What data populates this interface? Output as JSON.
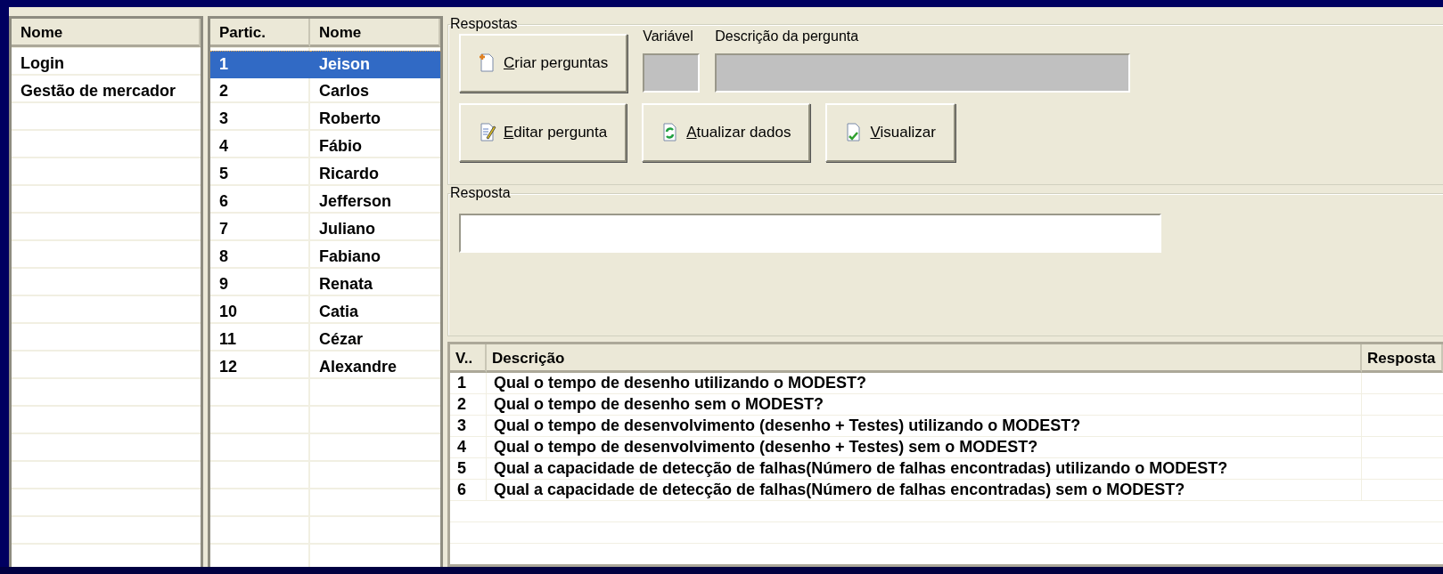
{
  "processes": {
    "columns": [
      "Nome"
    ],
    "rows": [
      {
        "name": "Login"
      },
      {
        "name": "Gestão de mercador"
      }
    ]
  },
  "participants": {
    "columns": [
      "Partic.",
      "Nome"
    ],
    "rows": [
      {
        "id": "1",
        "name": "Jeison",
        "selected": true
      },
      {
        "id": "2",
        "name": "Carlos",
        "selected": false
      },
      {
        "id": "3",
        "name": "Roberto",
        "selected": false
      },
      {
        "id": "4",
        "name": "Fábio",
        "selected": false
      },
      {
        "id": "5",
        "name": "Ricardo",
        "selected": false
      },
      {
        "id": "6",
        "name": "Jefferson",
        "selected": false
      },
      {
        "id": "7",
        "name": "Juliano",
        "selected": false
      },
      {
        "id": "8",
        "name": "Fabiano",
        "selected": false
      },
      {
        "id": "9",
        "name": "Renata",
        "selected": false
      },
      {
        "id": "10",
        "name": "Catia",
        "selected": false
      },
      {
        "id": "11",
        "name": "Cézar",
        "selected": false
      },
      {
        "id": "12",
        "name": "Alexandre",
        "selected": false
      }
    ]
  },
  "respostas_group": {
    "title": "Respostas",
    "buttons": [
      {
        "label": "Criar perguntas"
      },
      {
        "label": "Editar pergunta"
      },
      {
        "label": "Atualizar dados"
      },
      {
        "label": "Visualizar"
      }
    ],
    "fields": [
      {
        "label": "Variável",
        "disabled": true
      },
      {
        "label": "Descrição da pergunta",
        "disabled": true
      }
    ]
  },
  "resposta_group": {
    "title": "Resposta",
    "field": {
      "disabled": false
    }
  },
  "questions": {
    "columns": [
      "V..",
      "Descrição",
      "Resposta"
    ],
    "rows": [
      {
        "v": "1",
        "description": "Qual o tempo de desenho utilizando o MODEST?"
      },
      {
        "v": "2",
        "description": "Qual o tempo de desenho sem o MODEST?"
      },
      {
        "v": "3",
        "description": "Qual o tempo de desenvolvimento (desenho + Testes) utilizando o MODEST?"
      },
      {
        "v": "4",
        "description": "Qual o tempo de desenvolvimento (desenho + Testes) sem o MODEST?"
      },
      {
        "v": "5",
        "description": "Qual a capacidade de detecção de falhas(Número de falhas encontradas) utilizando o MODEST?"
      },
      {
        "v": "6",
        "description": "Qual a capacidade de detecção de falhas(Número de falhas encontradas) sem o MODEST?"
      }
    ]
  }
}
